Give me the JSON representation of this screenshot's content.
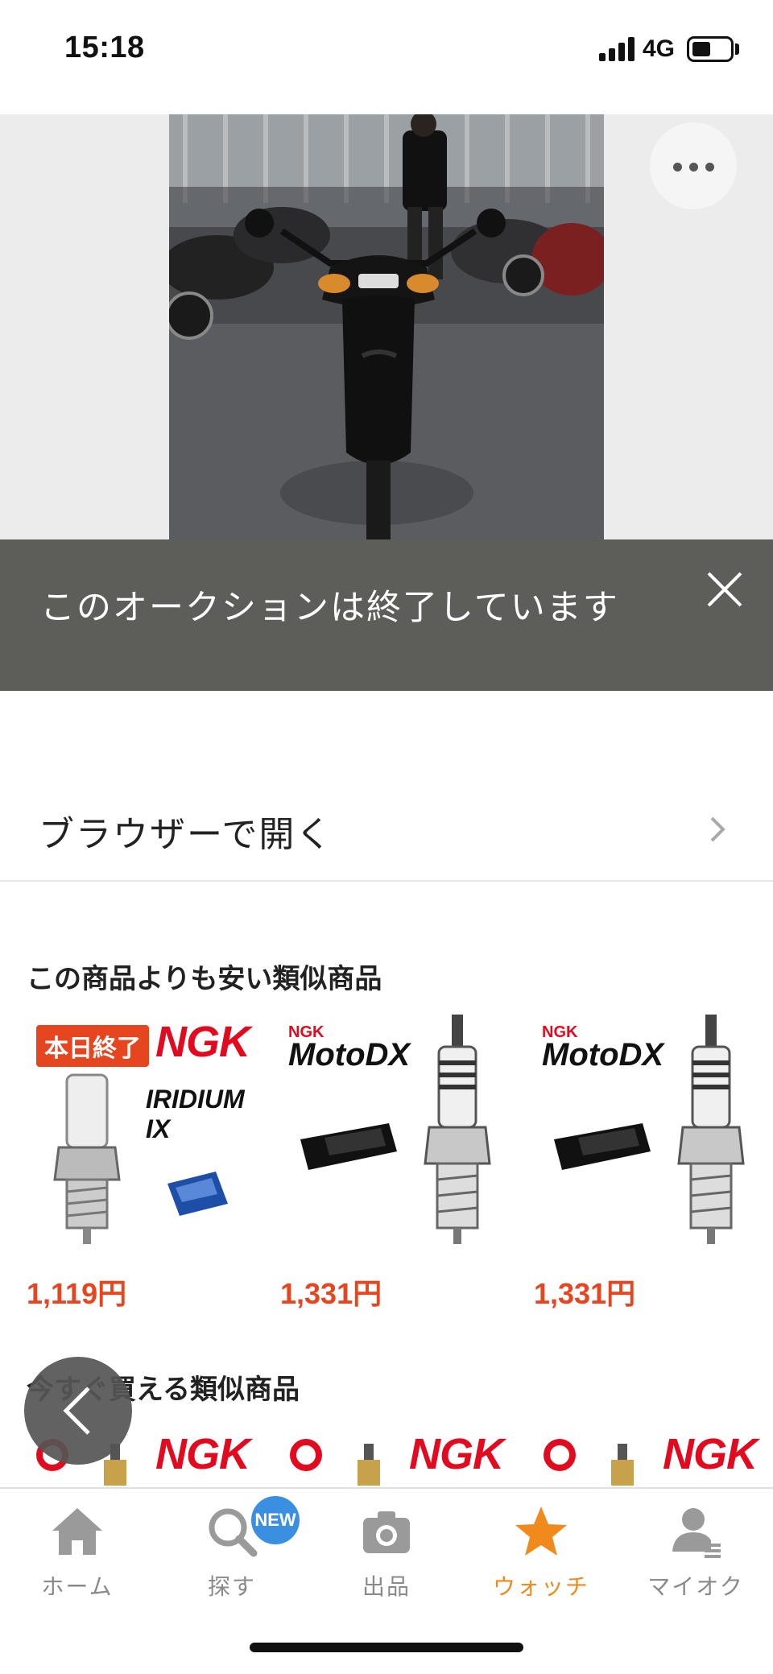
{
  "status_bar": {
    "time": "15:18",
    "network": "4G"
  },
  "banner": {
    "text": "このオークションは終了しています"
  },
  "browser": {
    "label": "ブラウザーで開く"
  },
  "sections": {
    "cheaper_title": "この商品よりも安い類似商品",
    "now_title_partial": "今すぐ買える類似商品"
  },
  "products": [
    {
      "price": "1,119円",
      "badge": "本日終了",
      "brand": "NGK",
      "product_text": "IRIDIUM IX"
    },
    {
      "price": "1,331円",
      "brand": "NGK",
      "product_text": "MotoDX"
    },
    {
      "price": "1,331円",
      "brand": "NGK",
      "product_text": "MotoDX"
    }
  ],
  "row2_brand": "NGK",
  "tabs": [
    {
      "label": "ホーム",
      "icon": "home-icon",
      "active": false
    },
    {
      "label": "探す",
      "icon": "search-icon",
      "active": false,
      "badge": "NEW"
    },
    {
      "label": "出品",
      "icon": "camera-icon",
      "active": false
    },
    {
      "label": "ウォッチ",
      "icon": "star-icon",
      "active": true
    },
    {
      "label": "マイオク",
      "icon": "user-icon",
      "active": false
    }
  ],
  "colors": {
    "price": "#e5461f",
    "active_tab": "#f08a1c",
    "inactive_tab": "#8a8a8a",
    "banner_bg": "#5d5e5a",
    "brand_red": "#e10a1f",
    "new_badge": "#3b8fe0"
  }
}
